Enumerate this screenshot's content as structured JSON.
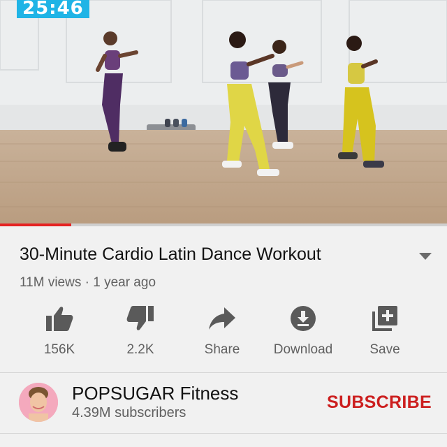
{
  "player": {
    "timer": "25:46",
    "progress": 0.16
  },
  "video": {
    "title": "30-Minute Cardio Latin Dance Workout",
    "meta": "11M views · 1 year ago"
  },
  "actions": [
    {
      "label": "156K",
      "icon": "thumbs-up-icon"
    },
    {
      "label": "2.2K",
      "icon": "thumbs-down-icon"
    },
    {
      "label": "Share",
      "icon": "share-icon"
    },
    {
      "label": "Download",
      "icon": "download-icon"
    },
    {
      "label": "Save",
      "icon": "playlist-add-icon"
    }
  ],
  "channel": {
    "name": "POPSUGAR Fitness",
    "subscribers": "4.39M subscribers",
    "subscribe_label": "SUBSCRIBE"
  },
  "colors": {
    "accent": "#cc1f1f",
    "timer_bg": "#1fb4e6",
    "progress": "#e52222"
  }
}
